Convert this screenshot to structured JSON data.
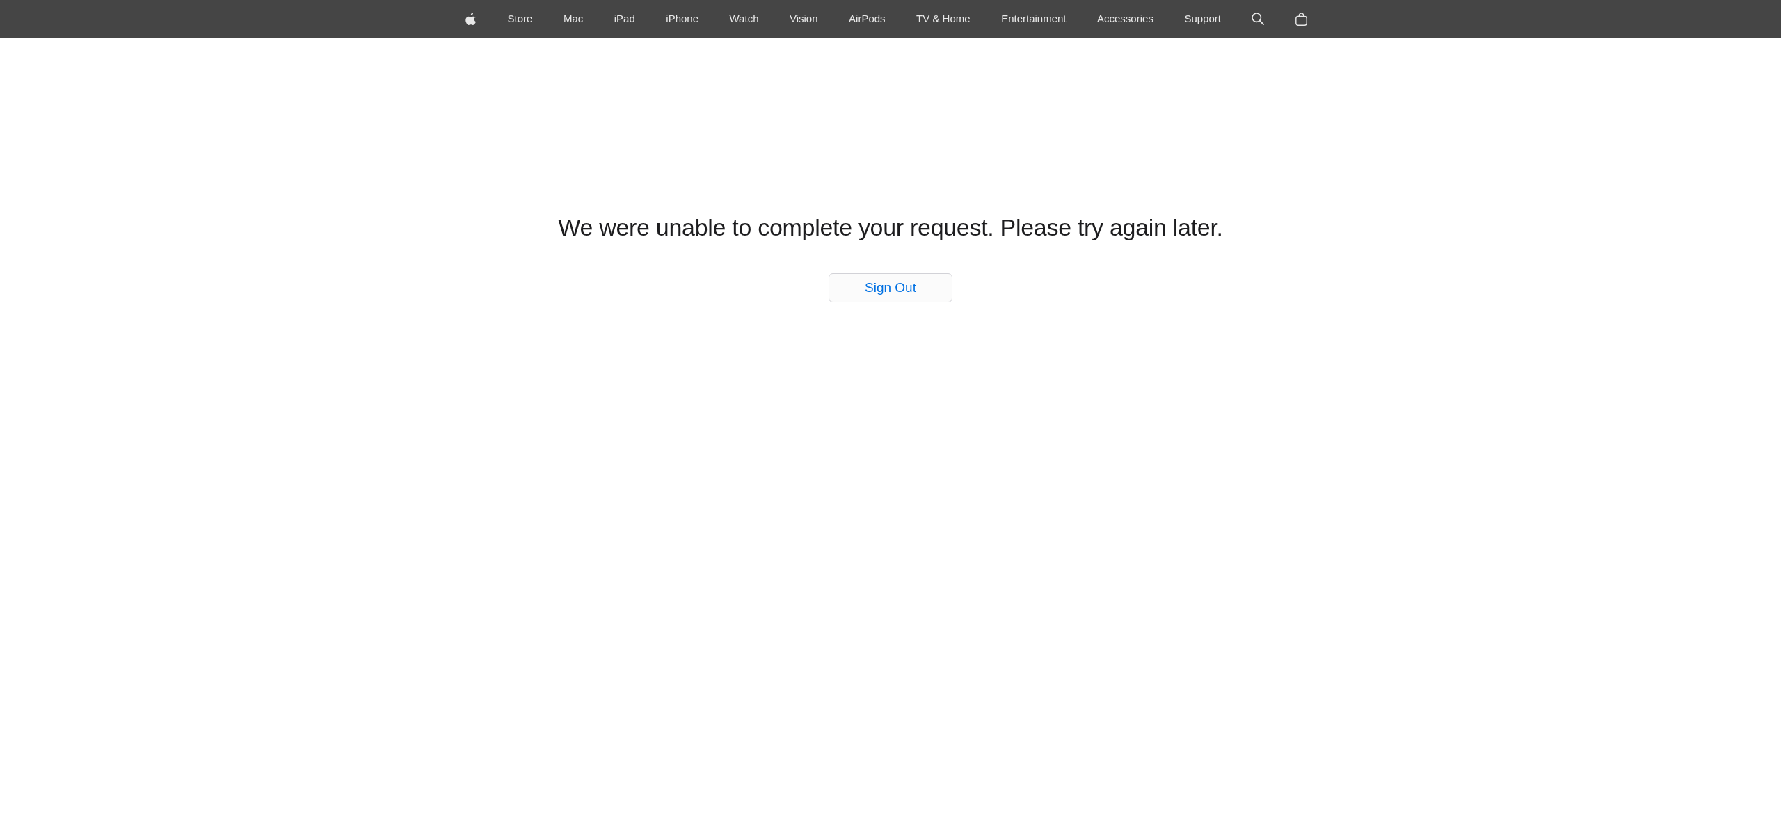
{
  "nav": {
    "items": [
      "Store",
      "Mac",
      "iPad",
      "iPhone",
      "Watch",
      "Vision",
      "AirPods",
      "TV & Home",
      "Entertainment",
      "Accessories",
      "Support"
    ]
  },
  "message": "We were unable to complete your request. Please try again later.",
  "button": {
    "label": "Sign Out"
  }
}
